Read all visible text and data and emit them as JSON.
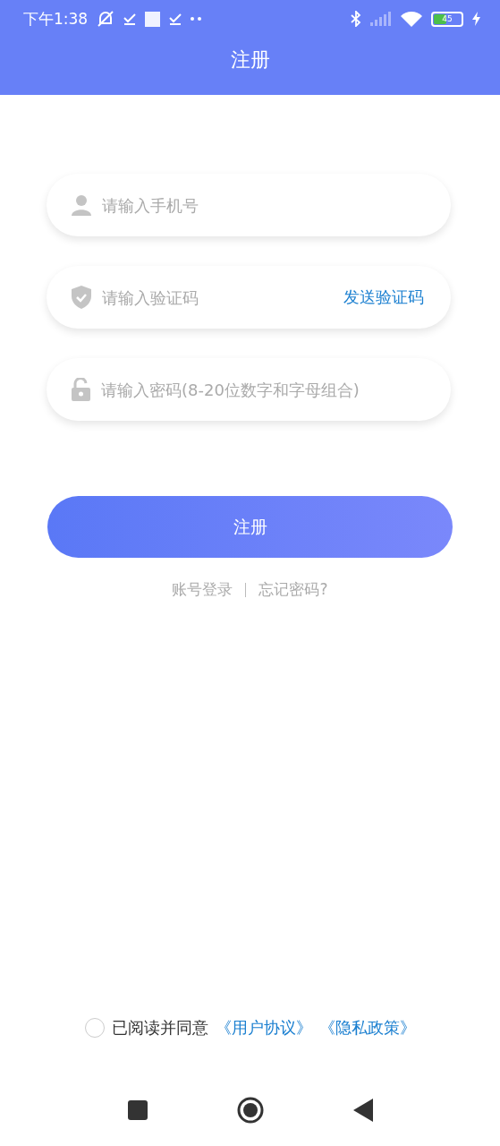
{
  "status_bar": {
    "time": "下午1:38",
    "battery": "45"
  },
  "header": {
    "title": "注册"
  },
  "fields": [
    {
      "kind": "phone",
      "placeholder": "请输入手机号"
    },
    {
      "kind": "code",
      "placeholder": "请输入验证码",
      "action": "发送验证码"
    },
    {
      "kind": "password",
      "placeholder": "请输入密码(8-20位数字和字母组合)"
    }
  ],
  "submit_button": "注册",
  "links": [
    "账号登录",
    "忘记密码?"
  ],
  "agreement": {
    "checked": false,
    "text": "已阅读并同意",
    "links": [
      "《用户协议》",
      "《隐私政策》"
    ]
  }
}
